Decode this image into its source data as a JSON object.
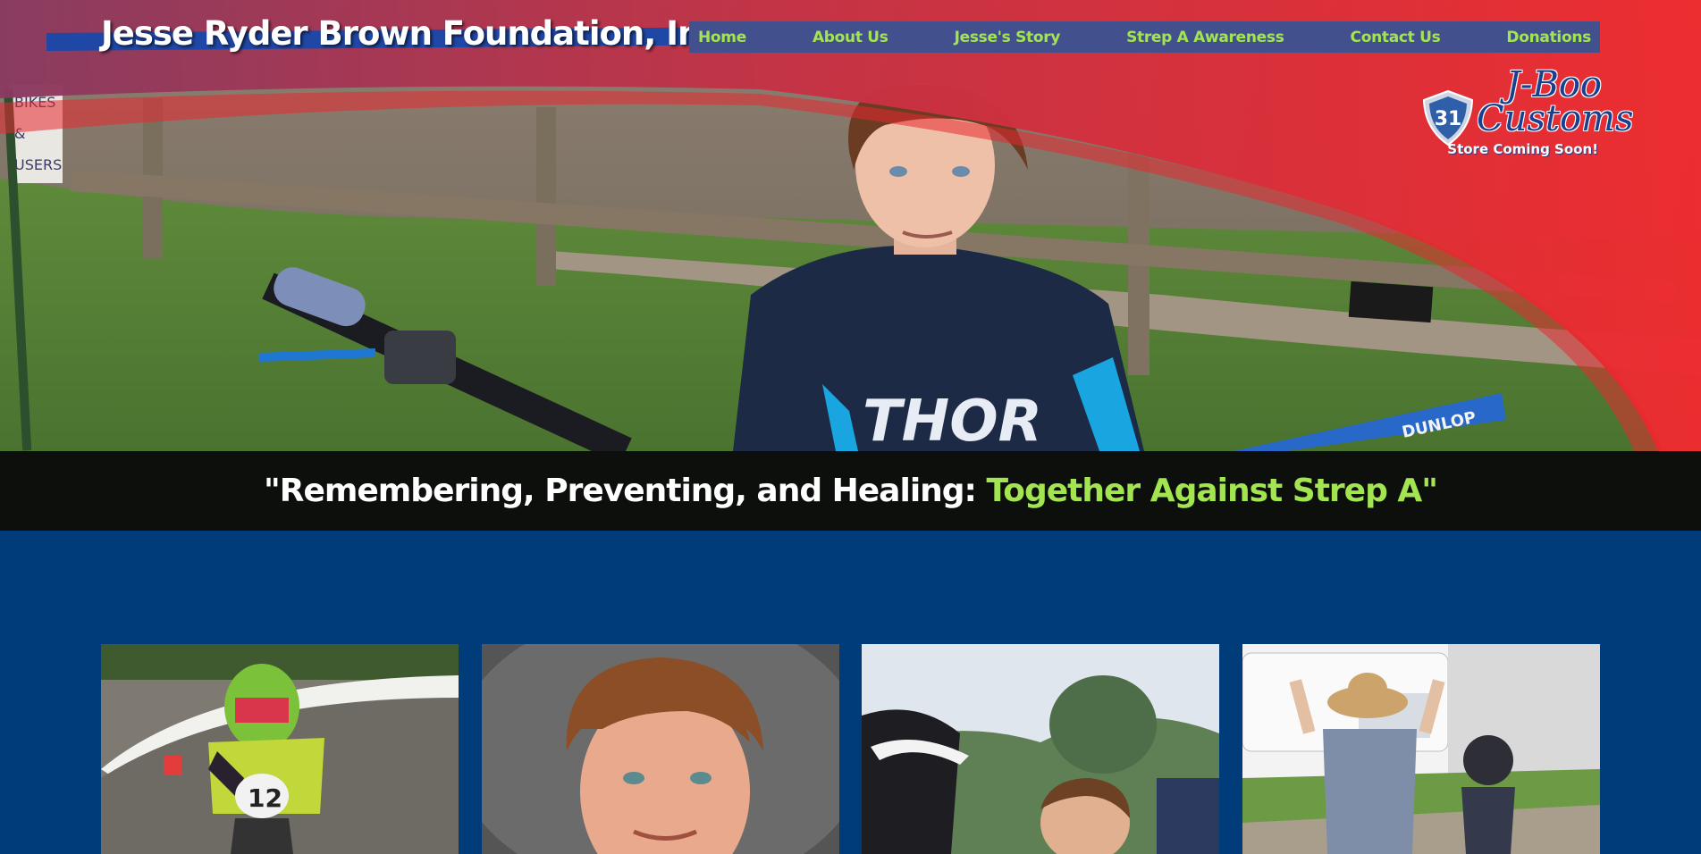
{
  "site": {
    "title": "Jesse Ryder Brown Foundation, Inc"
  },
  "nav": {
    "items": [
      {
        "label": "Home"
      },
      {
        "label": "About Us"
      },
      {
        "label": "Jesse's Story"
      },
      {
        "label": "Strep A Awareness"
      },
      {
        "label": "Contact Us"
      },
      {
        "label": "Donations"
      }
    ]
  },
  "logo": {
    "number": "31",
    "line1": "J-Boo",
    "line2": "Customs",
    "subtitle": "Store Coming Soon!"
  },
  "hero": {
    "sign_text": [
      "BIKES",
      "&",
      "USERS"
    ],
    "jersey_text": "THOR",
    "fender_text": "DUNLOP"
  },
  "tagline": {
    "white": "\"Remembering, Preventing, and Healing: ",
    "green": "Together Against Strep A\""
  },
  "cards": {
    "bike_number": "12"
  },
  "colors": {
    "nav_text": "#a3e550",
    "nav_bg": "#43508e",
    "banner_red": "#e8282f",
    "page_blue": "#003b7a",
    "tagline_bg": "#0d0f0d",
    "tagline_accent": "#a3e550"
  }
}
